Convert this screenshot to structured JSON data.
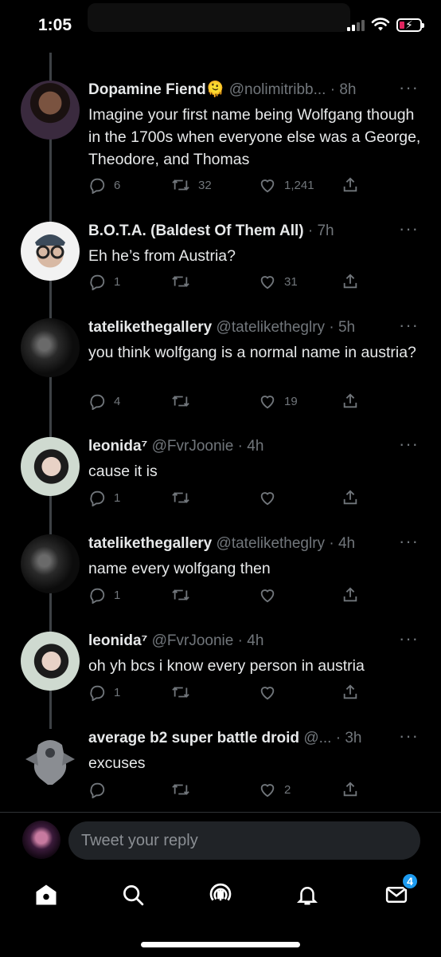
{
  "status_bar": {
    "time": "1:05"
  },
  "tweets": [
    {
      "name": "Dopamine Fiend🫠",
      "handle": "@nolimitribb...",
      "time": "· 8h",
      "text": "Imagine your first name being Wolfgang though in the 1700s when everyone else was a George, Theodore, and Thomas",
      "replies": "6",
      "retweets": "32",
      "likes": "1,241"
    },
    {
      "name": "B.O.T.A. (Baldest Of Them All)",
      "handle": "",
      "time": "· 7h",
      "text": "Eh he’s from Austria?",
      "replies": "1",
      "retweets": "",
      "likes": "31"
    },
    {
      "name": "tatelikethegallery",
      "handle": "@tateliketheglry",
      "time": "· 5h",
      "text": "you think wolfgang is a normal name in austria?",
      "replies": "4",
      "retweets": "",
      "likes": "19"
    },
    {
      "name": "leonida⁷",
      "handle": "@FvrJoonie",
      "time": "· 4h",
      "text": "cause it is",
      "replies": "1",
      "retweets": "",
      "likes": ""
    },
    {
      "name": "tatelikethegallery",
      "handle": "@tateliketheglry",
      "time": "· 4h",
      "text": "name every wolfgang then",
      "replies": "1",
      "retweets": "",
      "likes": ""
    },
    {
      "name": "leonida⁷",
      "handle": "@FvrJoonie",
      "time": "· 4h",
      "text": "oh yh bcs i know every person in austria",
      "replies": "1",
      "retweets": "",
      "likes": ""
    },
    {
      "name": "average b2 super battle droid",
      "handle": "@...",
      "time": "· 3h",
      "text": "excuses",
      "replies": "",
      "retweets": "",
      "likes": "2"
    }
  ],
  "reply_bar": {
    "placeholder": "Tweet your reply"
  },
  "tab_bar": {
    "messages_badge": "4"
  },
  "colors": {
    "background": "#000000",
    "text": "#e7e9ea",
    "muted": "#71767b",
    "accent": "#1d9bf0",
    "input": "#202327"
  },
  "icons": [
    "reply-icon",
    "retweet-icon",
    "like-icon",
    "share-icon",
    "more-icon",
    "home-icon",
    "search-icon",
    "spaces-icon",
    "notifications-icon",
    "messages-icon"
  ]
}
